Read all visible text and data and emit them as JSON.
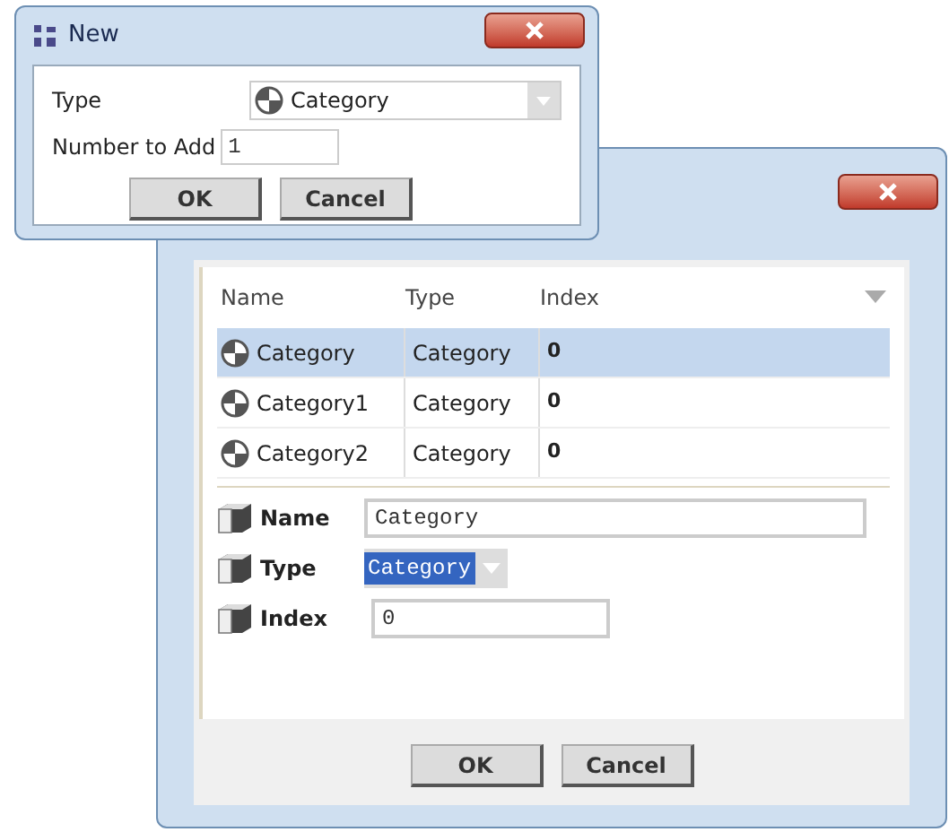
{
  "new_dialog": {
    "title": "New",
    "type_label": "Type",
    "type_value": "Category",
    "number_label": "Number to Add",
    "number_value": "1",
    "buttons": [
      "OK",
      "Cancel"
    ]
  },
  "manager": {
    "columns": [
      "Name",
      "Type",
      "Index"
    ],
    "rows": [
      {
        "name": "Category",
        "type": "Category",
        "index": "0",
        "selected": true
      },
      {
        "name": "Category1",
        "type": "Category",
        "index": "0",
        "selected": false
      },
      {
        "name": "Category2",
        "type": "Category",
        "index": "0",
        "selected": false
      }
    ],
    "properties": [
      {
        "kind": "text",
        "label": "Name",
        "value": "Category"
      },
      {
        "kind": "select",
        "label": "Type",
        "value": "Category"
      },
      {
        "kind": "short",
        "label": "Index",
        "value": "0"
      }
    ],
    "buttons": [
      "OK",
      "Cancel"
    ]
  }
}
